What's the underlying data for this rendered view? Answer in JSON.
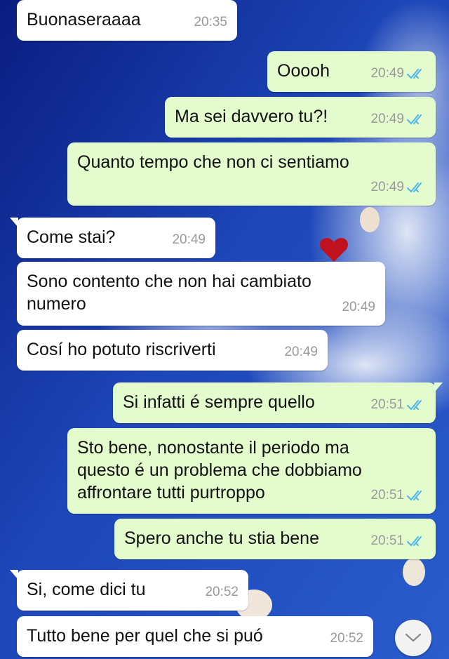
{
  "messages": [
    {
      "dir": "in",
      "text": "Buonaseraaaa",
      "time": "20:35"
    },
    {
      "dir": "out",
      "text": "Ooooh",
      "time": "20:49",
      "status": "read"
    },
    {
      "dir": "out",
      "text": "Ma sei davvero tu?!",
      "time": "20:49",
      "status": "read"
    },
    {
      "dir": "out",
      "text": "Quanto tempo che non ci sentiamo",
      "time": "20:49",
      "status": "read"
    },
    {
      "dir": "in",
      "text": "Come stai?",
      "time": "20:49",
      "tail": true
    },
    {
      "dir": "in",
      "text": "Sono contento che non hai cambiato\nnumero",
      "time": "20:49"
    },
    {
      "dir": "in",
      "text": "Cosí ho potuto riscriverti",
      "time": "20:49"
    },
    {
      "dir": "out",
      "text": "Si infatti é sempre quello",
      "time": "20:51",
      "status": "read",
      "tail": true
    },
    {
      "dir": "out",
      "text": "Sto bene, nonostante il periodo ma\nquesto é un problema che dobbiamo\naffrontare tutti purtroppo",
      "time": "20:51",
      "status": "read"
    },
    {
      "dir": "out",
      "text": "Spero anche tu stia bene",
      "time": "20:51",
      "status": "read"
    },
    {
      "dir": "in",
      "text": "Si, come dici tu",
      "time": "20:52",
      "tail": true
    },
    {
      "dir": "in",
      "text": "Tutto bene per quel che si puó",
      "time": "20:52"
    }
  ],
  "scroll_button": {
    "icon": "chevron-down-icon"
  },
  "colors": {
    "incoming_bubble": "#ffffff",
    "outgoing_bubble": "#e3fbcd",
    "read_tick": "#4fb6ec",
    "timestamp": "#9a9a9a"
  }
}
